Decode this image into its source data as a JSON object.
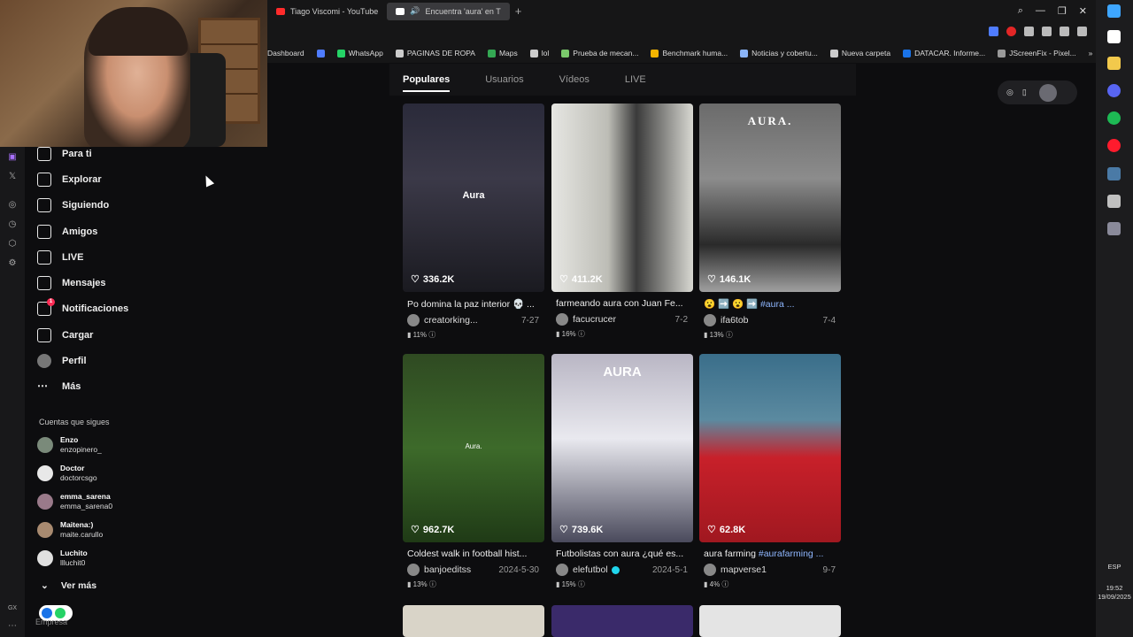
{
  "tabs": [
    {
      "label": "Tiago Viscomi - YouTube",
      "color": "#ff2b2b",
      "active": false
    },
    {
      "label": "Encuentra 'aura' en T",
      "color": "#ffffff",
      "active": true
    }
  ],
  "bookmarks": [
    {
      "label": "Dashboard",
      "color": "#ffffff"
    },
    {
      "label": "",
      "color": "#4f7cff"
    },
    {
      "label": "WhatsApp",
      "color": "#25d366"
    },
    {
      "label": "PAGINAS DE ROPA",
      "color": "#cccccc"
    },
    {
      "label": "Maps",
      "color": "#34a853"
    },
    {
      "label": "lol",
      "color": "#cccccc"
    },
    {
      "label": "Prueba de mecan...",
      "color": "#7ac96b"
    },
    {
      "label": "Benchmark huma...",
      "color": "#f4b400"
    },
    {
      "label": "Noticias y cobertu...",
      "color": "#8ab4f8"
    },
    {
      "label": "Nueva carpeta",
      "color": "#cccccc"
    },
    {
      "label": "DATACAR. Informe...",
      "color": "#1a73e8"
    },
    {
      "label": "JScreenFix - Pixel...",
      "color": "#999999"
    }
  ],
  "nav": [
    {
      "label": "Para ti",
      "icon": "home-icon",
      "badge": ""
    },
    {
      "label": "Explorar",
      "icon": "compass-icon",
      "badge": ""
    },
    {
      "label": "Siguiendo",
      "icon": "following-icon",
      "badge": ""
    },
    {
      "label": "Amigos",
      "icon": "friends-icon",
      "badge": ""
    },
    {
      "label": "LIVE",
      "icon": "live-icon",
      "badge": ""
    },
    {
      "label": "Mensajes",
      "icon": "messages-icon",
      "badge": ""
    },
    {
      "label": "Notificaciones",
      "icon": "notifications-icon",
      "badge": "1"
    },
    {
      "label": "Cargar",
      "icon": "upload-icon",
      "badge": ""
    },
    {
      "label": "Perfil",
      "icon": "profile-icon",
      "badge": ""
    },
    {
      "label": "Más",
      "icon": "more-icon",
      "badge": ""
    }
  ],
  "following_title": "Cuentas que sigues",
  "following": [
    {
      "name": "Enzo",
      "handle": "enzopinero_",
      "color": "#7a8a7a"
    },
    {
      "name": "Doctor",
      "handle": "doctorcsgo",
      "color": "#e8e8e8"
    },
    {
      "name": "emma_sarena",
      "handle": "emma_sarena0",
      "color": "#9a7a8a"
    },
    {
      "name": "Maitena:)",
      "handle": "maite.carullo",
      "color": "#a88a70"
    },
    {
      "name": "Luchito",
      "handle": "llluchit0",
      "color": "#e0e0e0"
    }
  ],
  "see_more": "Ver más",
  "company": "Empresa",
  "filters": [
    "Populares",
    "Usuarios",
    "Vídeos",
    "LIVE"
  ],
  "active_filter": "Populares",
  "videos": [
    {
      "likes": "336.2K",
      "overlay": "Aura",
      "desc": "Po domina la paz interior 💀 ...",
      "tag": "",
      "user": "creatorking...",
      "date": "7-27",
      "stat": "11%",
      "verified": false,
      "bg": "linear-gradient(180deg,#2a2a3a 0%,#3b3948 40%,#1a1a20 100%)"
    },
    {
      "likes": "411.2K",
      "overlay": "",
      "desc": "farmeando aura con Juan Fe...",
      "tag": "",
      "user": "facucrucer",
      "date": "7-2",
      "stat": "16%",
      "verified": false,
      "bg": "linear-gradient(90deg,#e6e6e2 0%,#bdbdb6 40%,#3a3a3a 60%,#d8d8d2 100%)"
    },
    {
      "likes": "146.1K",
      "overlay": "AURA.",
      "desc": "😮 ➡️ 😮 ➡️ ",
      "tag": "#aura ...",
      "user": "ifa6tob",
      "date": "7-4",
      "stat": "13%",
      "verified": false,
      "bg": "linear-gradient(180deg,#6b6b6b 0%,#8c8c8c 40%,#2a2a2a 75%,#a0a0a0 100%)"
    },
    {
      "likes": "962.7K",
      "overlay": "Aura.",
      "desc": "Coldest walk in football hist...",
      "tag": "",
      "user": "banjoeditss",
      "date": "2024-5-30",
      "stat": "13%",
      "verified": false,
      "bg": "linear-gradient(180deg,#2f4a22 0%,#3d6a2a 50%,#1f3a16 100%)"
    },
    {
      "likes": "739.6K",
      "overlay": "AURA",
      "desc": "Futbolistas con aura ¿qué es...",
      "tag": "",
      "user": "elefutbol",
      "date": "2024-5-1",
      "stat": "15%",
      "verified": true,
      "bg": "linear-gradient(180deg,#b9b6c4 0%,#e9e9ef 45%,#4a4a5c 100%)"
    },
    {
      "likes": "62.8K",
      "overlay": "",
      "desc": "aura farming ",
      "tag": "#aurafarming ...",
      "user": "mapverse1",
      "date": "9-7",
      "stat": "4%",
      "verified": false,
      "bg": "linear-gradient(180deg,#3a6e8a 0%,#5b8aa0 35%,#c8202a 55%,#a01820 100%)"
    }
  ],
  "bottom_thumbs": [
    "#d9d4c8",
    "#3a2a6a",
    "#e4e4e4"
  ],
  "lang": "ESP",
  "time": "19:52",
  "date": "19/09/2025"
}
